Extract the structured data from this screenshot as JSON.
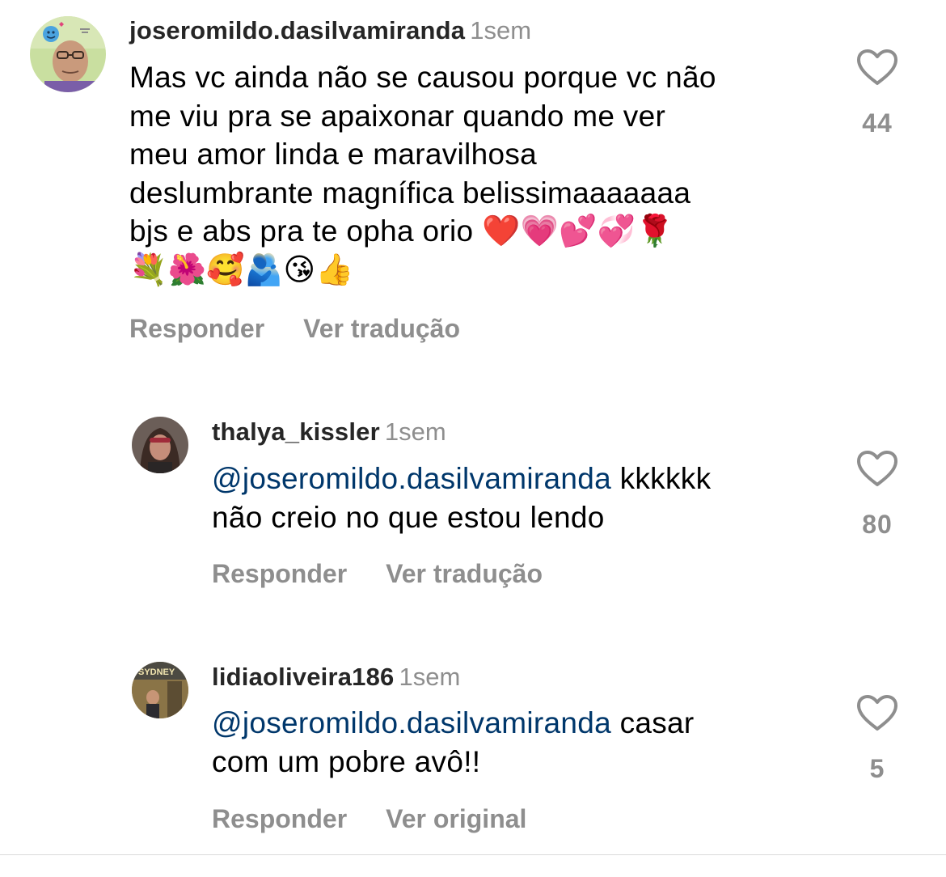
{
  "comments": [
    {
      "username": "joseromildo.dasilvamiranda",
      "time": "1sem",
      "mention": "",
      "text": "Mas vc ainda não se causou porque vc não\nme viu pra se apaixonar quando me ver\nmeu amor linda e maravilhosa\ndeslumbrante magnífica belissimaaaaaaa\nbjs e abs pra te opha orio ",
      "emojis": "❤️💗💕💞🌹\n💐🌺🥰🫂😘👍",
      "likes": "44",
      "reply_label": "Responder",
      "translate_label": "Ver tradução"
    },
    {
      "username": "thalya_kissler",
      "time": "1sem",
      "mention": "@joseromildo.dasilvamiranda",
      "text": " kkkkkk\nnão creio no que estou lendo",
      "emojis": "",
      "likes": "80",
      "reply_label": "Responder",
      "translate_label": "Ver tradução"
    },
    {
      "username": "lidiaoliveira186",
      "time": "1sem",
      "mention": "@joseromildo.dasilvamiranda",
      "text": " casar\ncom um pobre avô!!",
      "emojis": "",
      "likes": "5",
      "reply_label": "Responder",
      "translate_label": "Ver original"
    }
  ],
  "avatar_texts": {
    "lidia_sign": "SYDNEY"
  },
  "colors": {
    "username": "#262626",
    "secondary": "#8e8e8e",
    "mention": "#00376b",
    "text": "#000000"
  },
  "icons": {
    "like": "heart-outline-icon"
  }
}
